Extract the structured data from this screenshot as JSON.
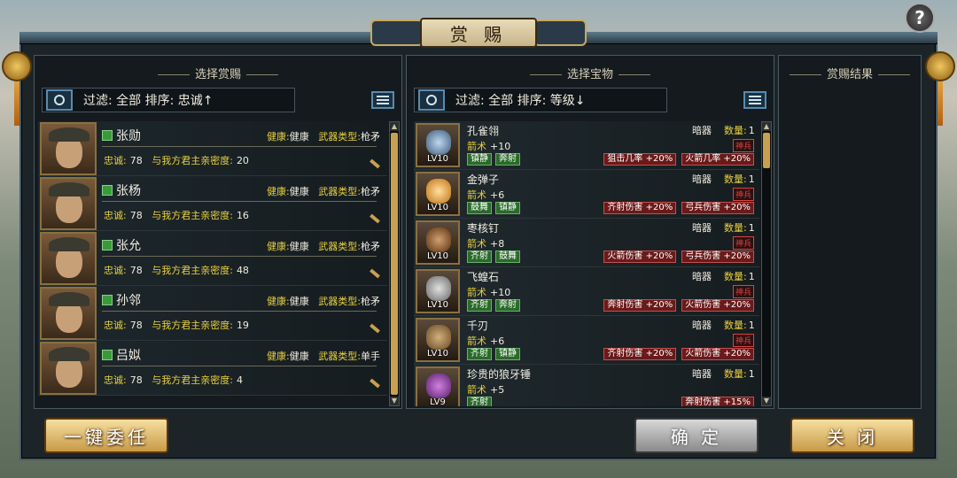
{
  "title": "赏 赐",
  "help_label": "?",
  "left_panel": {
    "title": "选择赏赐",
    "filter_text": "过滤:  全部    排序:  忠诚↑"
  },
  "middle_panel": {
    "title": "选择宝物",
    "filter_text": "过滤:  全部    排序:  等级↓"
  },
  "right_panel": {
    "title": "赏赐结果"
  },
  "generals": [
    {
      "name": "张勋",
      "health_label": "健康:",
      "health": "健康",
      "weapon_label": "武器类型:",
      "weapon": "枪矛",
      "loyalty_label": "忠诚:",
      "loyalty": "78",
      "intimacy_label": "与我方君主亲密度:",
      "intimacy": "20"
    },
    {
      "name": "张杨",
      "health_label": "健康:",
      "health": "健康",
      "weapon_label": "武器类型:",
      "weapon": "枪矛",
      "loyalty_label": "忠诚:",
      "loyalty": "78",
      "intimacy_label": "与我方君主亲密度:",
      "intimacy": "16"
    },
    {
      "name": "张允",
      "health_label": "健康:",
      "health": "健康",
      "weapon_label": "武器类型:",
      "weapon": "枪矛",
      "loyalty_label": "忠诚:",
      "loyalty": "78",
      "intimacy_label": "与我方君主亲密度:",
      "intimacy": "48"
    },
    {
      "name": "孙邻",
      "health_label": "健康:",
      "health": "健康",
      "weapon_label": "武器类型:",
      "weapon": "枪矛",
      "loyalty_label": "忠诚:",
      "loyalty": "78",
      "intimacy_label": "与我方君主亲密度:",
      "intimacy": "19"
    },
    {
      "name": "吕姒",
      "health_label": "健康:",
      "health": "健康",
      "weapon_label": "武器类型:",
      "weapon": "单手",
      "loyalty_label": "忠诚:",
      "loyalty": "78",
      "intimacy_label": "与我方君主亲密度:",
      "intimacy": "4"
    }
  ],
  "items": [
    {
      "name": "孔雀翎",
      "lv": "LV10",
      "type": "暗器",
      "qty_label": "数量:",
      "qty": "1",
      "bonus_label": "箭术",
      "bonus": "+10",
      "badge": "神兵",
      "tags": [
        "镇静",
        "奔射"
      ],
      "rtags": [
        "狙击几率 +20%",
        "火箭几率 +20%"
      ]
    },
    {
      "name": "金弹子",
      "lv": "LV10",
      "type": "暗器",
      "qty_label": "数量:",
      "qty": "1",
      "bonus_label": "箭术",
      "bonus": "+6",
      "badge": "神兵",
      "tags": [
        "鼓舞",
        "镇静"
      ],
      "rtags": [
        "齐射伤害 +20%",
        "弓兵伤害 +20%"
      ]
    },
    {
      "name": "枣核钉",
      "lv": "LV10",
      "type": "暗器",
      "qty_label": "数量:",
      "qty": "1",
      "bonus_label": "箭术",
      "bonus": "+8",
      "badge": "神兵",
      "tags": [
        "齐射",
        "鼓舞"
      ],
      "rtags": [
        "火箭伤害 +20%",
        "弓兵伤害 +20%"
      ]
    },
    {
      "name": "飞蝗石",
      "lv": "LV10",
      "type": "暗器",
      "qty_label": "数量:",
      "qty": "1",
      "bonus_label": "箭术",
      "bonus": "+10",
      "badge": "神兵",
      "tags": [
        "齐射",
        "奔射"
      ],
      "rtags": [
        "奔射伤害 +20%",
        "火箭伤害 +20%"
      ]
    },
    {
      "name": "千刃",
      "lv": "LV10",
      "type": "暗器",
      "qty_label": "数量:",
      "qty": "1",
      "bonus_label": "箭术",
      "bonus": "+6",
      "badge": "神兵",
      "tags": [
        "齐射",
        "镇静"
      ],
      "rtags": [
        "齐射伤害 +20%",
        "火箭伤害 +20%"
      ]
    },
    {
      "name": "珍贵的狼牙锤",
      "lv": "LV9",
      "type": "暗器",
      "qty_label": "数量:",
      "qty": "1",
      "bonus_label": "箭术",
      "bonus": "+5",
      "badge": "",
      "tags": [
        "齐射"
      ],
      "rtags": [
        "奔射伤害 +15%"
      ]
    }
  ],
  "buttons": {
    "auto_assign": "一键委任",
    "confirm": "确 定",
    "close": "关 闭"
  }
}
